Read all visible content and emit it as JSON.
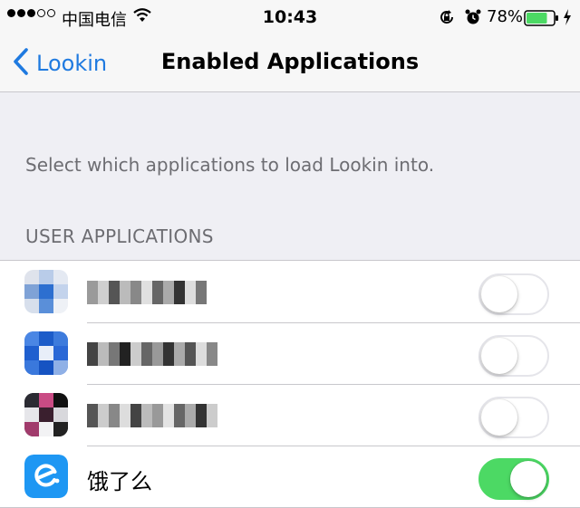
{
  "status_bar": {
    "carrier": "中国电信",
    "time": "10:43",
    "battery_percent": "78%",
    "battery_level": 0.78,
    "signal_bars": 3,
    "icons": [
      "wifi-icon",
      "orientation-lock-icon",
      "alarm-icon",
      "battery-icon",
      "charging-icon"
    ]
  },
  "nav": {
    "back_label": "Lookin",
    "title": "Enabled Applications"
  },
  "description": "Select which applications to load Lookin into.",
  "section_header": "USER APPLICATIONS",
  "apps": [
    {
      "name": "",
      "name_obscured": true,
      "enabled": false
    },
    {
      "name": "",
      "name_obscured": true,
      "enabled": false
    },
    {
      "name": "",
      "name_obscured": true,
      "enabled": false
    },
    {
      "name": "饿了么",
      "name_obscured": false,
      "enabled": true
    }
  ],
  "colors": {
    "accent_blue": "#1f7ae0",
    "toggle_on": "#4cd964",
    "group_background": "#efeff4",
    "secondary_text": "#6d6d72",
    "battery_green": "#4cd964"
  }
}
